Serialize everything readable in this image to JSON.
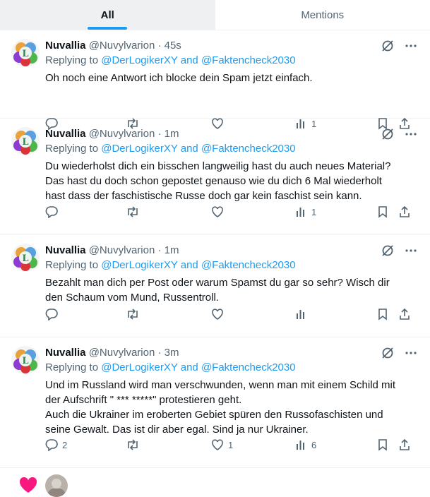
{
  "tabs": [
    {
      "label": "All",
      "active": true
    },
    {
      "label": "Mentions",
      "active": false
    }
  ],
  "tweets": [
    {
      "name": "Nuvallia",
      "meta": "@Nuvylvarion · 45s",
      "reply_prefix": "Replying to",
      "reply_user1": "@DerLogikerXY",
      "reply_and": "and",
      "reply_user2": "@Faktencheck2030",
      "text": "Oh noch eine Antwort ich blocke dein Spam jetzt einfach.",
      "replies": "",
      "retweets": "",
      "likes": "",
      "views": "1"
    },
    {
      "name": "Nuvallia",
      "meta": "@Nuvylvarion · 1m",
      "reply_prefix": "Replying to",
      "reply_user1": "@DerLogikerXY",
      "reply_and": "and",
      "reply_user2": "@Faktencheck2030",
      "text": "Du wiederholst dich ein bisschen langweilig hast du auch neues Material?\nDas hast du doch schon gepostet genauso wie du dich 6 Mal wiederholt\nhast dass der faschistische Russe doch gar kein faschist sein kann.",
      "replies": "",
      "retweets": "",
      "likes": "",
      "views": "1"
    },
    {
      "name": "Nuvallia",
      "meta": "@Nuvylvarion · 1m",
      "reply_prefix": "Replying to",
      "reply_user1": "@DerLogikerXY",
      "reply_and": "and",
      "reply_user2": "@Faktencheck2030",
      "text": "Bezahlt man dich per Post oder warum Spamst du gar so sehr? Wisch dir\nden Schaum vom Mund, Russentroll.",
      "replies": "",
      "retweets": "",
      "likes": "",
      "views": ""
    },
    {
      "name": "Nuvallia",
      "meta": "@Nuvylvarion · 3m",
      "reply_prefix": "Replying to",
      "reply_user1": "@DerLogikerXY",
      "reply_and": "and",
      "reply_user2": "@Faktencheck2030",
      "text": "Und im Russland wird man verschwunden, wenn man mit einem Schild mit\nder Aufschrift \" *** *****\" protestieren geht.\nAuch die Ukrainer im eroberten Gebiet spüren den Russofaschisten und\nseine Gewalt. Das ist dir aber egal. Sind ja nur Ukrainer.",
      "replies": "2",
      "retweets": "",
      "likes": "1",
      "views": "6"
    }
  ],
  "icons": {
    "reply": "reply-icon",
    "retweet": "retweet-icon",
    "like": "heart-icon",
    "views": "views-icon",
    "bookmark": "bookmark-icon",
    "share": "share-icon",
    "grok": "grok-icon",
    "more": "more-icon"
  },
  "colors": {
    "accent": "#1d9bf0",
    "muted": "#536471",
    "text": "#0f1419",
    "heart": "#f91880"
  }
}
